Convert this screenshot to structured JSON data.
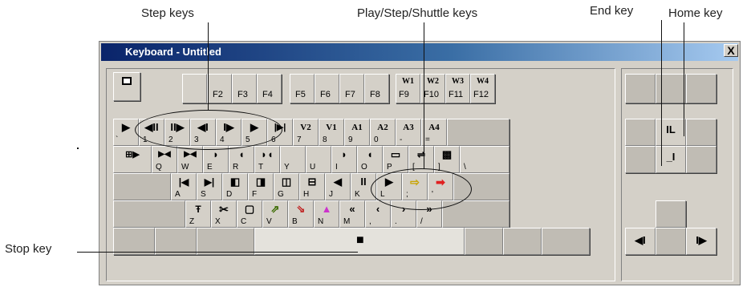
{
  "callouts": {
    "step_keys": "Step keys",
    "play_step_shuttle_keys": "Play/Step/Shuttle keys",
    "end_key": "End key",
    "home_key": "Home key",
    "stop_key": "Stop key"
  },
  "window": {
    "title": "Keyboard - Untitled",
    "close_glyph": "X"
  },
  "function_row": {
    "f_labels": [
      "F2",
      "F3",
      "F4",
      "F5",
      "F6",
      "F7",
      "F8"
    ],
    "w_keys": [
      {
        "top": "W1",
        "label": "F9"
      },
      {
        "top": "W2",
        "label": "F10"
      },
      {
        "top": "W3",
        "label": "F11"
      },
      {
        "top": "W4",
        "label": "F12"
      }
    ]
  },
  "number_row": {
    "labels": [
      "`",
      "1",
      "2",
      "3",
      "4",
      "5",
      "6",
      "7",
      "8",
      "9",
      "0",
      "-",
      "="
    ],
    "symbols": [
      "▶",
      "◀II",
      "II▶",
      "◀I",
      "I▶",
      "▶",
      "|▶|",
      "V2",
      "V1",
      "A1",
      "A2",
      "A3",
      "A4"
    ]
  },
  "qwerty_row": {
    "labels": [
      "Q",
      "W",
      "E",
      "R",
      "T",
      "Y",
      "U",
      "I",
      "O",
      "P",
      "[",
      "]",
      "\\"
    ],
    "symbols": [
      "⊞▶",
      "▶◀",
      "▶◀",
      "◗",
      "◖",
      "◗◖",
      "",
      "",
      "◗",
      "◖",
      "▭",
      "⇌",
      "▩"
    ]
  },
  "asdf_row": {
    "labels": [
      "A",
      "S",
      "D",
      "F",
      "G",
      "H",
      "J",
      "K",
      "L",
      ";",
      "'"
    ],
    "symbols": [
      "|◀",
      "▶|",
      "◧",
      "◨",
      "◫",
      "⊟",
      "◀",
      "II",
      "▶",
      "⇨",
      "➡"
    ]
  },
  "zxcv_row": {
    "labels": [
      "Z",
      "X",
      "C",
      "V",
      "B",
      "N",
      "M",
      ",",
      ".",
      "/"
    ],
    "symbols": [
      "Ŧ",
      "✂",
      "▢",
      "⇗",
      "⇘",
      "▲",
      "«",
      "‹",
      "›",
      "»"
    ]
  },
  "space_row": {
    "stop_symbol": "■"
  },
  "nav_cluster": {
    "home_symbol": "IL",
    "end_symbol": "_I"
  },
  "arrow_cluster": {
    "left_symbol": "◀I",
    "right_symbol": "I▶"
  },
  "colors": {
    "title_start": "#0a246a",
    "title_end": "#a6caf0",
    "key_face": "#d4d0c8",
    "red_arrow": "#e02020",
    "yellow_arrow": "#e8c400",
    "magenta_triangle": "#cc33cc"
  }
}
